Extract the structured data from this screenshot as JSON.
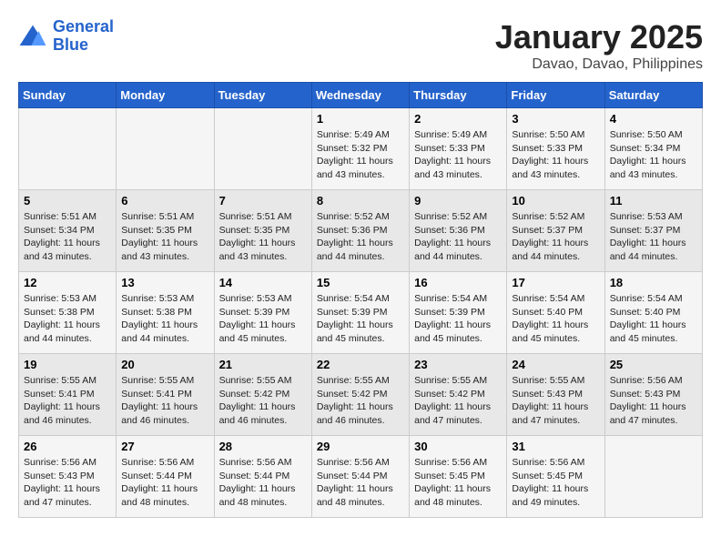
{
  "logo": {
    "line1": "General",
    "line2": "Blue"
  },
  "title": "January 2025",
  "subtitle": "Davao, Davao, Philippines",
  "days_of_week": [
    "Sunday",
    "Monday",
    "Tuesday",
    "Wednesday",
    "Thursday",
    "Friday",
    "Saturday"
  ],
  "weeks": [
    [
      {
        "day": "",
        "info": ""
      },
      {
        "day": "",
        "info": ""
      },
      {
        "day": "",
        "info": ""
      },
      {
        "day": "1",
        "info": "Sunrise: 5:49 AM\nSunset: 5:32 PM\nDaylight: 11 hours and 43 minutes."
      },
      {
        "day": "2",
        "info": "Sunrise: 5:49 AM\nSunset: 5:33 PM\nDaylight: 11 hours and 43 minutes."
      },
      {
        "day": "3",
        "info": "Sunrise: 5:50 AM\nSunset: 5:33 PM\nDaylight: 11 hours and 43 minutes."
      },
      {
        "day": "4",
        "info": "Sunrise: 5:50 AM\nSunset: 5:34 PM\nDaylight: 11 hours and 43 minutes."
      }
    ],
    [
      {
        "day": "5",
        "info": "Sunrise: 5:51 AM\nSunset: 5:34 PM\nDaylight: 11 hours and 43 minutes."
      },
      {
        "day": "6",
        "info": "Sunrise: 5:51 AM\nSunset: 5:35 PM\nDaylight: 11 hours and 43 minutes."
      },
      {
        "day": "7",
        "info": "Sunrise: 5:51 AM\nSunset: 5:35 PM\nDaylight: 11 hours and 43 minutes."
      },
      {
        "day": "8",
        "info": "Sunrise: 5:52 AM\nSunset: 5:36 PM\nDaylight: 11 hours and 44 minutes."
      },
      {
        "day": "9",
        "info": "Sunrise: 5:52 AM\nSunset: 5:36 PM\nDaylight: 11 hours and 44 minutes."
      },
      {
        "day": "10",
        "info": "Sunrise: 5:52 AM\nSunset: 5:37 PM\nDaylight: 11 hours and 44 minutes."
      },
      {
        "day": "11",
        "info": "Sunrise: 5:53 AM\nSunset: 5:37 PM\nDaylight: 11 hours and 44 minutes."
      }
    ],
    [
      {
        "day": "12",
        "info": "Sunrise: 5:53 AM\nSunset: 5:38 PM\nDaylight: 11 hours and 44 minutes."
      },
      {
        "day": "13",
        "info": "Sunrise: 5:53 AM\nSunset: 5:38 PM\nDaylight: 11 hours and 44 minutes."
      },
      {
        "day": "14",
        "info": "Sunrise: 5:53 AM\nSunset: 5:39 PM\nDaylight: 11 hours and 45 minutes."
      },
      {
        "day": "15",
        "info": "Sunrise: 5:54 AM\nSunset: 5:39 PM\nDaylight: 11 hours and 45 minutes."
      },
      {
        "day": "16",
        "info": "Sunrise: 5:54 AM\nSunset: 5:39 PM\nDaylight: 11 hours and 45 minutes."
      },
      {
        "day": "17",
        "info": "Sunrise: 5:54 AM\nSunset: 5:40 PM\nDaylight: 11 hours and 45 minutes."
      },
      {
        "day": "18",
        "info": "Sunrise: 5:54 AM\nSunset: 5:40 PM\nDaylight: 11 hours and 45 minutes."
      }
    ],
    [
      {
        "day": "19",
        "info": "Sunrise: 5:55 AM\nSunset: 5:41 PM\nDaylight: 11 hours and 46 minutes."
      },
      {
        "day": "20",
        "info": "Sunrise: 5:55 AM\nSunset: 5:41 PM\nDaylight: 11 hours and 46 minutes."
      },
      {
        "day": "21",
        "info": "Sunrise: 5:55 AM\nSunset: 5:42 PM\nDaylight: 11 hours and 46 minutes."
      },
      {
        "day": "22",
        "info": "Sunrise: 5:55 AM\nSunset: 5:42 PM\nDaylight: 11 hours and 46 minutes."
      },
      {
        "day": "23",
        "info": "Sunrise: 5:55 AM\nSunset: 5:42 PM\nDaylight: 11 hours and 47 minutes."
      },
      {
        "day": "24",
        "info": "Sunrise: 5:55 AM\nSunset: 5:43 PM\nDaylight: 11 hours and 47 minutes."
      },
      {
        "day": "25",
        "info": "Sunrise: 5:56 AM\nSunset: 5:43 PM\nDaylight: 11 hours and 47 minutes."
      }
    ],
    [
      {
        "day": "26",
        "info": "Sunrise: 5:56 AM\nSunset: 5:43 PM\nDaylight: 11 hours and 47 minutes."
      },
      {
        "day": "27",
        "info": "Sunrise: 5:56 AM\nSunset: 5:44 PM\nDaylight: 11 hours and 48 minutes."
      },
      {
        "day": "28",
        "info": "Sunrise: 5:56 AM\nSunset: 5:44 PM\nDaylight: 11 hours and 48 minutes."
      },
      {
        "day": "29",
        "info": "Sunrise: 5:56 AM\nSunset: 5:44 PM\nDaylight: 11 hours and 48 minutes."
      },
      {
        "day": "30",
        "info": "Sunrise: 5:56 AM\nSunset: 5:45 PM\nDaylight: 11 hours and 48 minutes."
      },
      {
        "day": "31",
        "info": "Sunrise: 5:56 AM\nSunset: 5:45 PM\nDaylight: 11 hours and 49 minutes."
      },
      {
        "day": "",
        "info": ""
      }
    ]
  ]
}
